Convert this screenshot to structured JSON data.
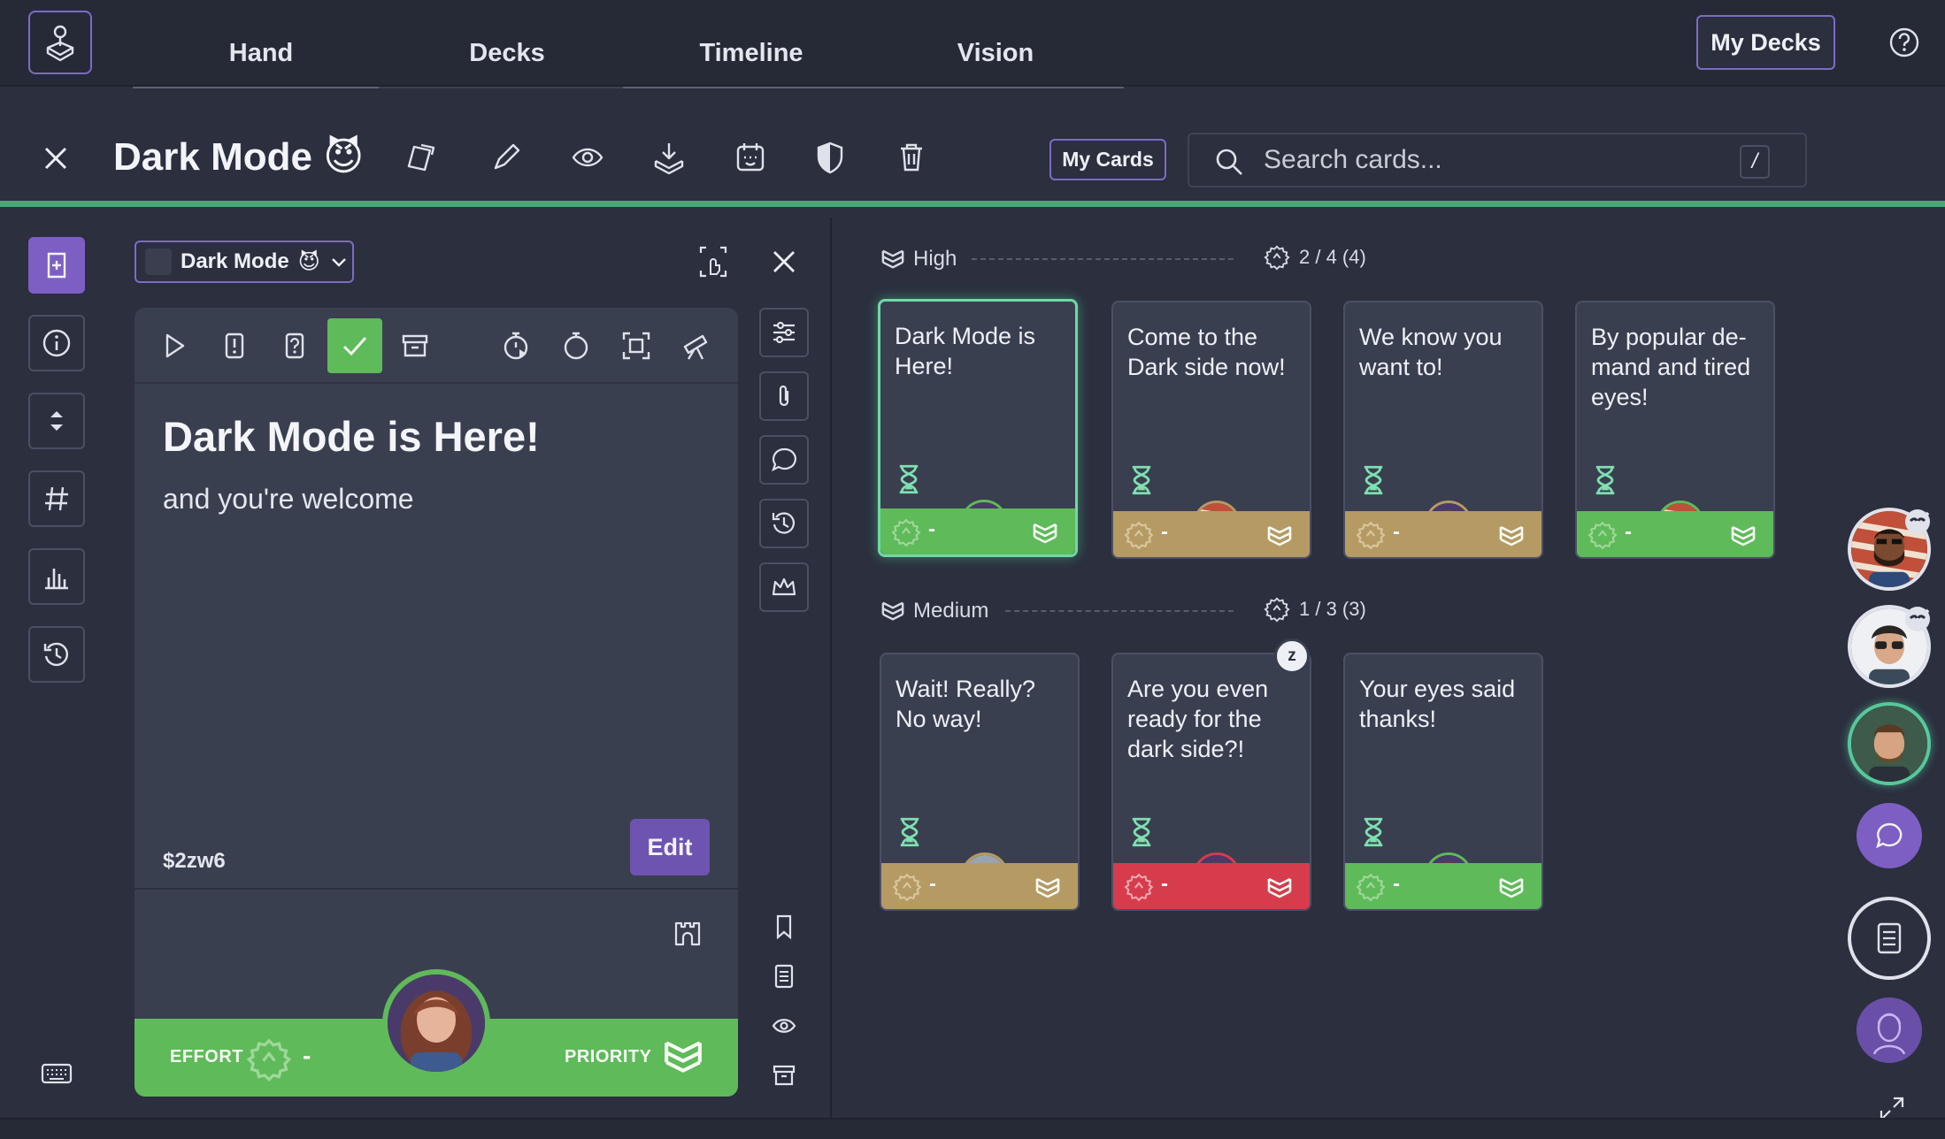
{
  "nav": {
    "tabs": [
      {
        "label": "Hand"
      },
      {
        "label": "Decks",
        "active": true
      },
      {
        "label": "Timeline"
      },
      {
        "label": "Vision"
      }
    ],
    "my_decks_label": "My Decks"
  },
  "deck": {
    "title": "Dark Mode",
    "title_emoji": "😈",
    "my_cards_label": "My Cards",
    "search_placeholder": "Search cards...",
    "search_shortcut": "/"
  },
  "panel": {
    "deck_select": "Dark Mode",
    "deck_select_emoji": "😈",
    "card": {
      "title": "Dark Mode is Here!",
      "description": "and you're welcome",
      "code": "$2zw6",
      "edit_label": "Edit",
      "effort_label": "EFFORT",
      "effort_value": "-",
      "priority_label": "PRIORITY"
    }
  },
  "board": {
    "groups": [
      {
        "label": "High",
        "stat": "2 / 4 (4)",
        "cards": [
          {
            "text": "Dark Mode is Here!",
            "status": "green",
            "effort": "-",
            "avatar": "woman",
            "selected": true
          },
          {
            "text": "Come to the Dark side now!",
            "status": "tan",
            "effort": "-",
            "avatar": "man-beard"
          },
          {
            "text": "We know you want to!",
            "status": "tan",
            "effort": "-",
            "avatar": "woman"
          },
          {
            "text": "By popular de-mand and tired eyes!",
            "status": "green",
            "effort": "-",
            "avatar": "man-beard"
          }
        ]
      },
      {
        "label": "Medium",
        "stat": "1 / 3 (3)",
        "cards": [
          {
            "text": "Wait! Really? No way!",
            "status": "tan",
            "effort": "-",
            "avatar": "man"
          },
          {
            "text": "Are you even ready for the dark side?!",
            "status": "red",
            "effort": "-",
            "avatar": "woman",
            "snoozed": true,
            "snooze_label": "z"
          },
          {
            "text": "Your eyes said thanks!",
            "status": "green",
            "effort": "-",
            "avatar": "woman"
          }
        ]
      }
    ]
  },
  "colors": {
    "accent": "#7d5fc4",
    "success": "#5fba5a",
    "warning": "#b59a64",
    "danger": "#d63c4c",
    "selection": "#6fd8a6",
    "background": "#2b2f3e"
  }
}
